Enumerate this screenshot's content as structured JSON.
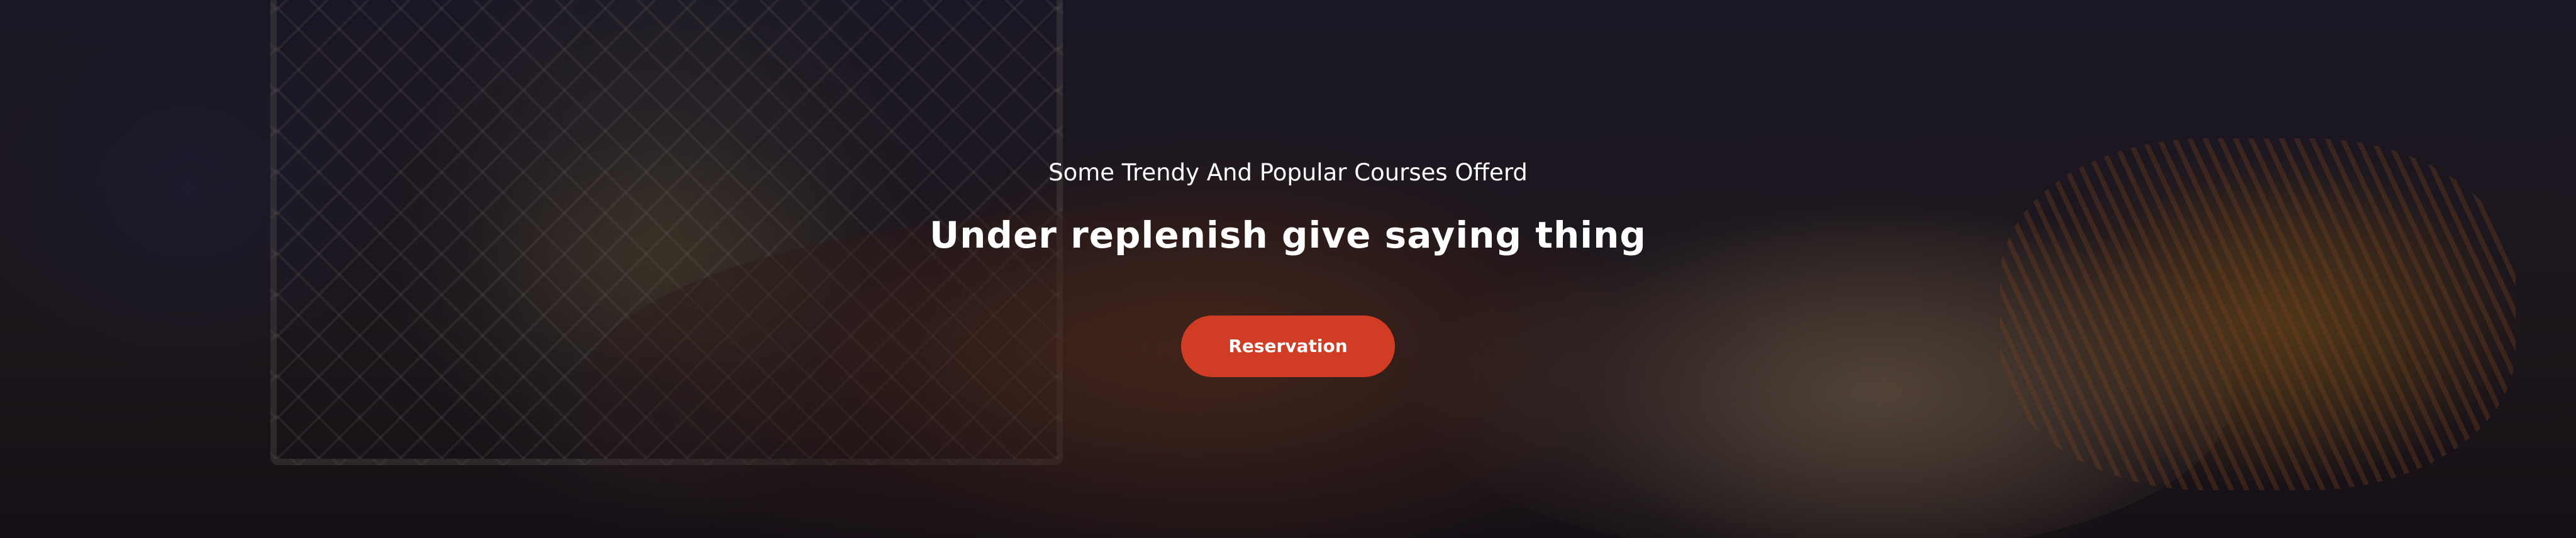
{
  "hero": {
    "subtitle": "Some Trendy And Popular Courses Offerd",
    "title": "Under replenish give saying thing",
    "cta_label": "Reservation"
  },
  "colors": {
    "button_bg": "#d13d24",
    "text": "#ffffff",
    "overlay": "rgba(15, 12, 30, 0.48)"
  }
}
